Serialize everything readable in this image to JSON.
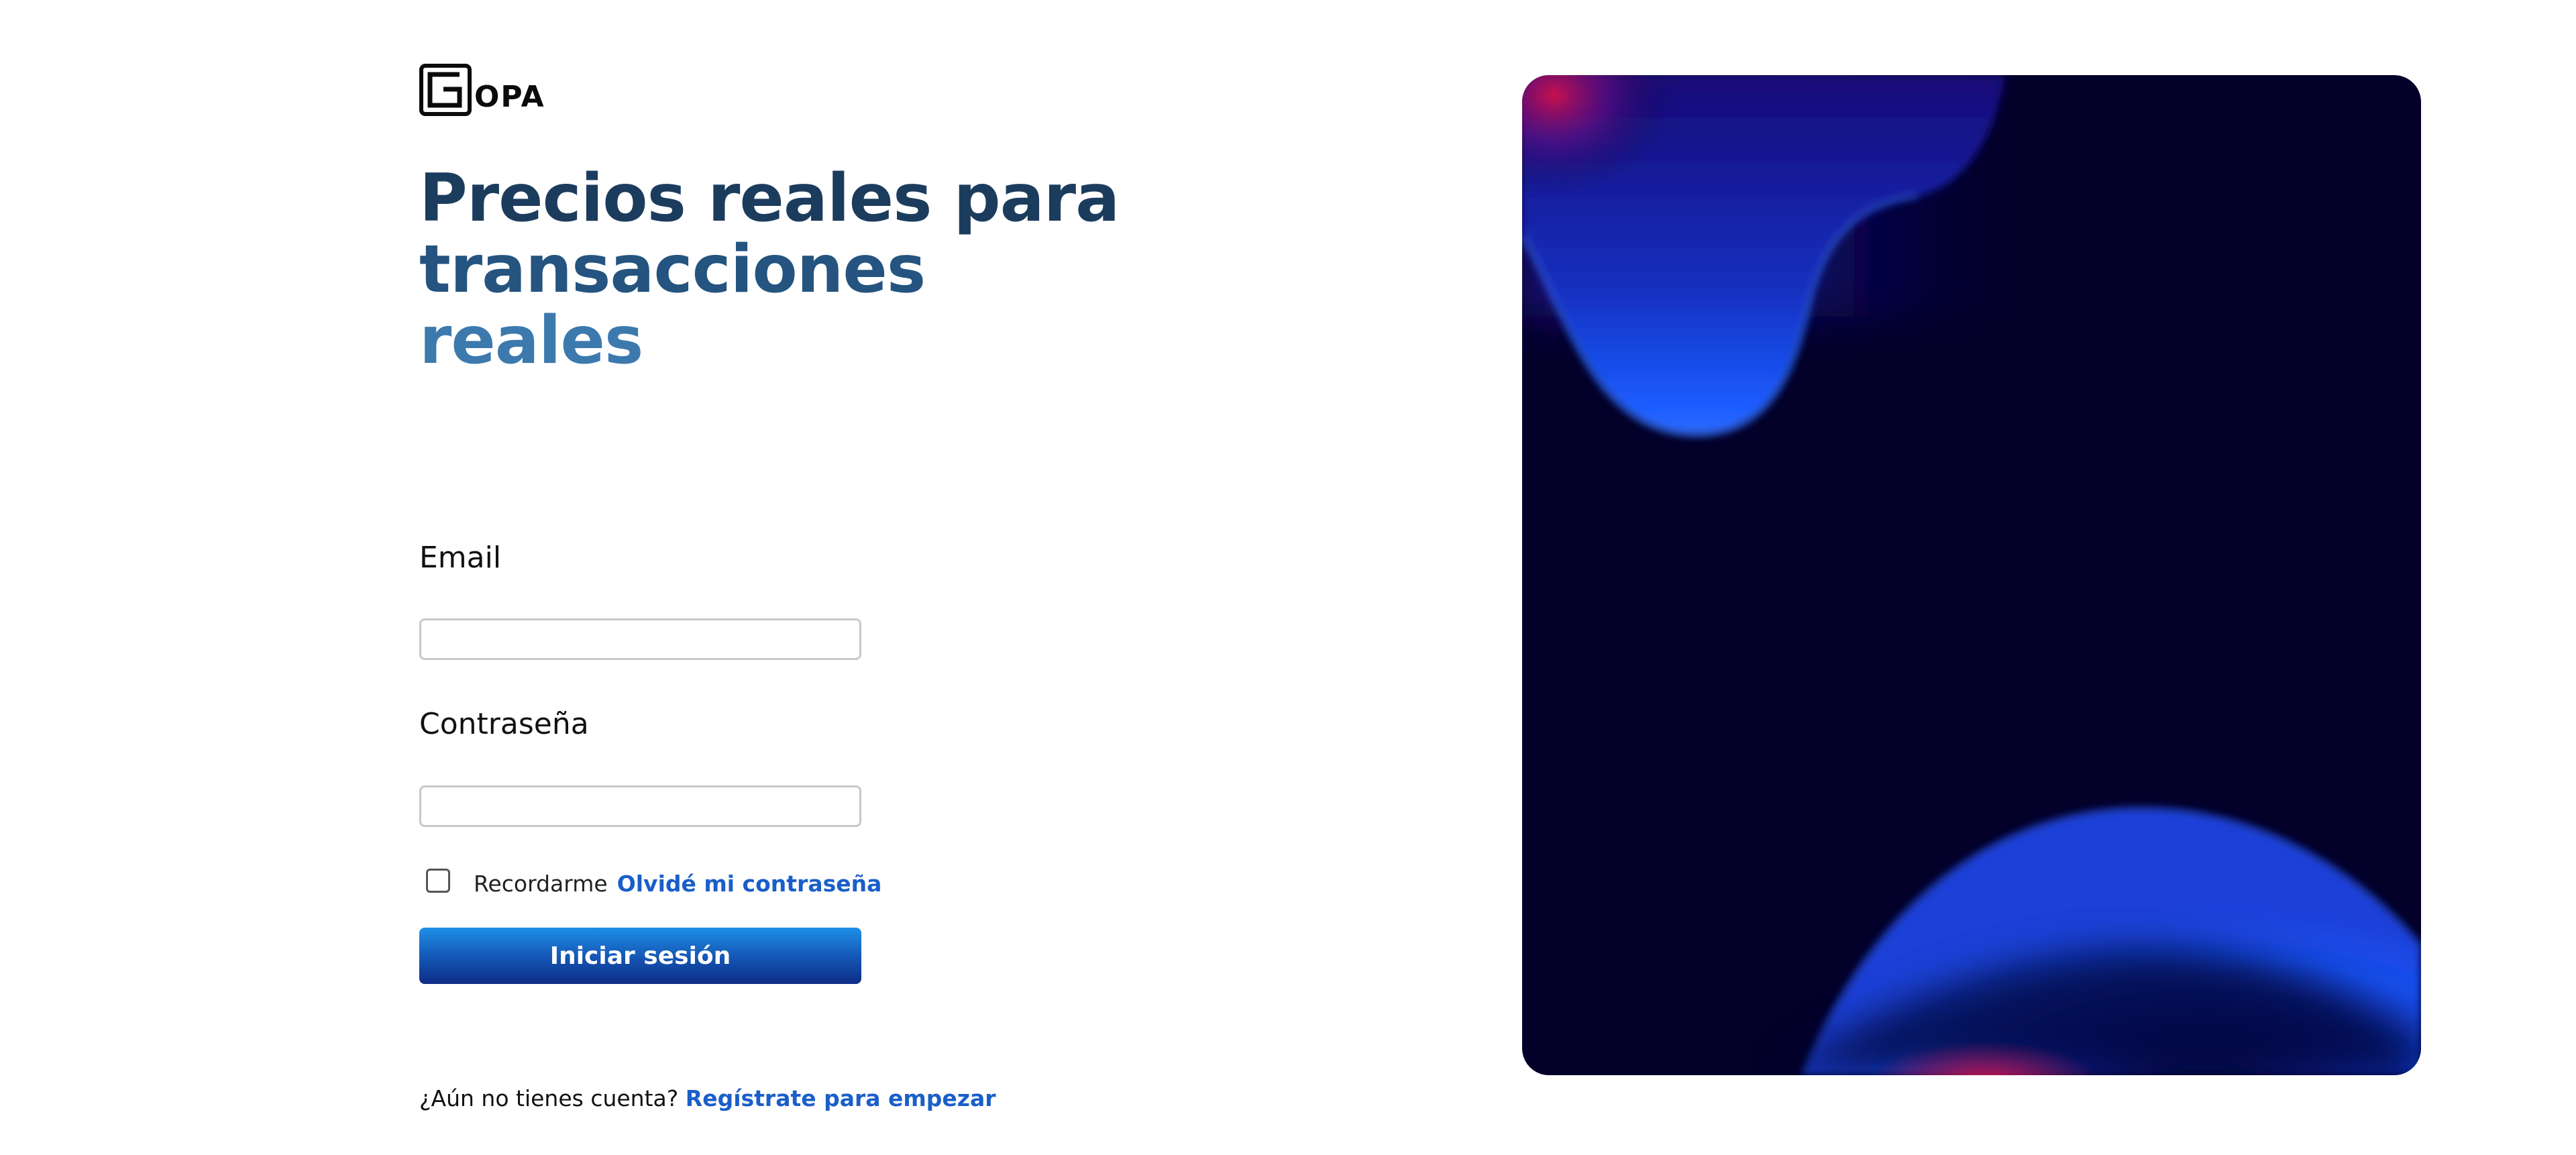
{
  "brand": {
    "logo_icon": "g-square-logo-icon",
    "name": "OPA"
  },
  "headline": {
    "line1": "Precios reales para",
    "line2": "transacciones",
    "line3": "reales"
  },
  "form": {
    "email_label": "Email",
    "email_value": "",
    "password_label": "Contraseña",
    "password_value": "",
    "remember_label": "Recordarme",
    "remember_checked": false,
    "forgot_link": "Olvidé mi contraseña",
    "submit_label": "Iniciar sesión"
  },
  "signup": {
    "prompt": "¿Aún no tienes cuenta?",
    "link": "Regístrate para empezar"
  },
  "colors": {
    "headline_dark": "#1c3c5e",
    "headline_mid": "#24547f",
    "headline_light": "#3c79ad",
    "link": "#1a5fc9",
    "button_top": "#1e8fe6",
    "button_bottom": "#0d2c86",
    "art_background": "#03002a"
  }
}
